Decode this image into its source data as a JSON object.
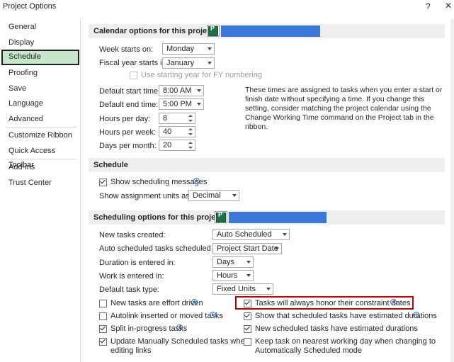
{
  "window": {
    "title": "Project Options",
    "help_glyph": "?",
    "close_glyph": "✕"
  },
  "nav": [
    "General",
    "Display",
    "Schedule",
    "Proofing",
    "Save",
    "Language",
    "Advanced",
    "Customize Ribbon",
    "Quick Access Toolbar",
    "Add-ins",
    "Trust Center"
  ],
  "calendar": {
    "header": "Calendar options for this project:",
    "week_starts_on_label": "Week starts on:",
    "week_starts_on_value": "Monday",
    "fiscal_year_label": "Fiscal year starts in:",
    "fiscal_year_value": "January",
    "fy_numbering_label": "Use starting year for FY numbering",
    "default_start_label": "Default start time:",
    "default_start_value": "8:00 AM",
    "default_end_label": "Default end time:",
    "default_end_value": "5:00 PM",
    "hours_per_day_label": "Hours per day:",
    "hours_per_day_value": "8",
    "hours_per_week_label": "Hours per week:",
    "hours_per_week_value": "40",
    "days_per_month_label": "Days per month:",
    "days_per_month_value": "20",
    "note": "These times are assigned to tasks when you enter a start or finish date without specifying a time. If you change this setting, consider matching the project calendar using the Change Working Time command on the Project tab in the ribbon."
  },
  "schedule": {
    "header": "Schedule",
    "show_messages_label": "Show scheduling messages",
    "show_units_label": "Show assignment units as a:",
    "show_units_value": "Decimal"
  },
  "sched_opts": {
    "header": "Scheduling options for this project:",
    "new_tasks_label": "New tasks created:",
    "new_tasks_value": "Auto Scheduled",
    "auto_sched_label": "Auto scheduled tasks scheduled on:",
    "auto_sched_value": "Project Start Date",
    "duration_label": "Duration is entered in:",
    "duration_value": "Days",
    "work_label": "Work is entered in:",
    "work_value": "Hours",
    "task_type_label": "Default task type:",
    "task_type_value": "Fixed Units",
    "effort_driven_label": "New tasks are effort driven",
    "autolink_label": "Autolink inserted or moved tasks",
    "split_label": "Split in-progress tasks",
    "update_manual_line1": "Update Manually Scheduled tasks when",
    "update_manual_line2": "editing links",
    "honor_constraints_label": "Tasks will always honor their constraint dates",
    "show_estimated_label": "Show that scheduled tasks have estimated durations",
    "new_estimated_label": "New scheduled tasks have estimated durations",
    "keep_task_line1": "Keep task on nearest working day when changing to",
    "keep_task_line2": "Automatically Scheduled mode"
  },
  "colors": {
    "selected_nav_bg": "#c6e7c9",
    "highlight_box": "#c00000",
    "project_bar": "#3b78d8"
  }
}
